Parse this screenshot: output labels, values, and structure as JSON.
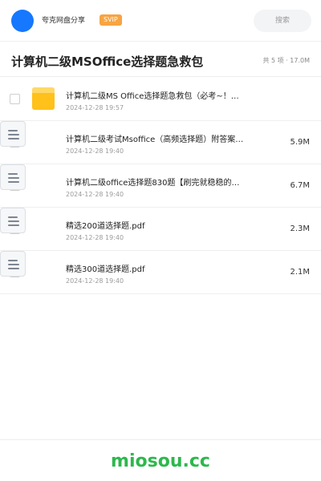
{
  "header": {
    "share_name": "夸克网盘分享",
    "badge": "SVIP",
    "search_placeholder": "搜索",
    "avatar_color": "#1677ff",
    "badge_color": "#f7a442"
  },
  "title_bar": {
    "title": "计算机二级MSOffice选择题急救包",
    "summary": "共 5 项 · 17.0M"
  },
  "files": [
    {
      "type": "folder",
      "icon": "folder-icon",
      "name": "计算机二级MS Office选择题急救包（必考~！…",
      "date": "2024-12-28 19:57",
      "size": ""
    },
    {
      "type": "file",
      "icon": "document-icon",
      "name": "计算机二级考试Msoffice（高频选择题）附答案…",
      "date": "2024-12-28 19:40",
      "size": "5.9M"
    },
    {
      "type": "file",
      "icon": "document-icon",
      "name": "计算机二级office选择题830题【刷完就稳稳的…",
      "date": "2024-12-28 19:40",
      "size": "6.7M"
    },
    {
      "type": "file",
      "icon": "document-icon",
      "name": "精选200道选择题.pdf",
      "date": "2024-12-28 19:40",
      "size": "2.3M"
    },
    {
      "type": "file",
      "icon": "document-icon",
      "name": "精选300道选择题.pdf",
      "date": "2024-12-28 19:40",
      "size": "2.1M"
    }
  ],
  "footer": {
    "watermark": "miosou.cc",
    "watermark_color": "#2db84d"
  }
}
